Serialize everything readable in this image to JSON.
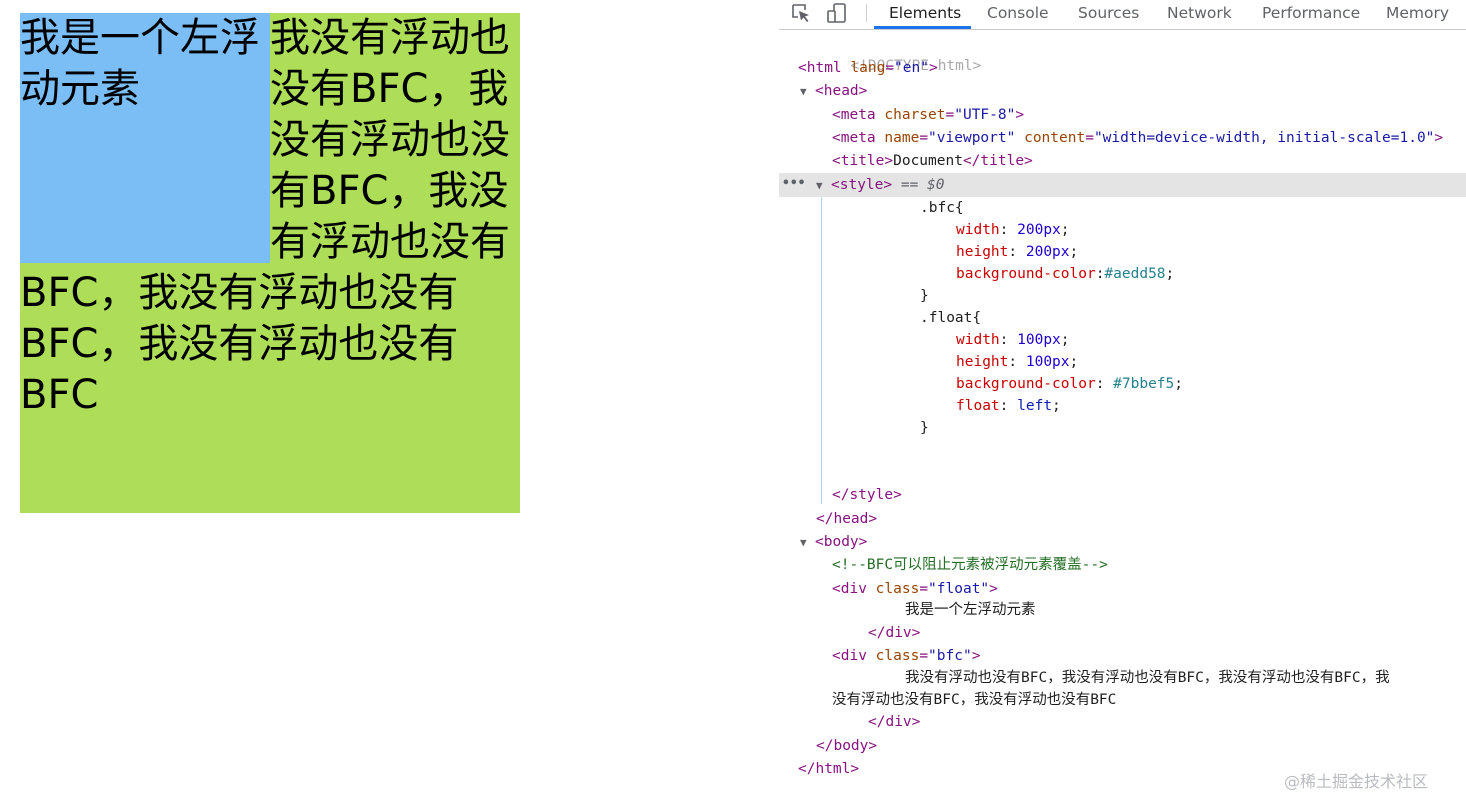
{
  "page": {
    "float_text": "我是一个左浮动元素",
    "bfc_text": "我没有浮动也没有BFC，我没有浮动也没有BFC，我没有浮动也没有BFC，我没有浮动也没有BFC，我没有浮动也没有BFC",
    "colors": {
      "float_bg": "#7bbef5",
      "bfc_bg": "#aedd58"
    }
  },
  "devtools": {
    "tabs": [
      "Elements",
      "Console",
      "Sources",
      "Network",
      "Performance",
      "Memory"
    ],
    "active_tab": "Elements",
    "icons": [
      "inspect-element-icon",
      "device-toolbar-icon"
    ],
    "selected_marker": "== $0",
    "lines": {
      "doctype": "<!DOCTYPE html>",
      "html_open_tag": "<html",
      "html_lang_attr": "lang",
      "html_lang_val": "\"en\"",
      "head_open": "<head>",
      "meta1_tag": "<meta",
      "meta1_attr": "charset",
      "meta1_val": "\"UTF-8\"",
      "meta2_tag": "<meta",
      "meta2_attr1": "name",
      "meta2_val1": "\"viewport\"",
      "meta2_attr2": "content",
      "meta2_val2": "\"width=device-width, initial-scale=1.0\"",
      "title_open": "<title>",
      "title_text": "Document",
      "title_close": "</title>",
      "style_open": "<style>",
      "css_bfc_selector": ".bfc{",
      "css_bfc_width_prop": "width",
      "css_bfc_width_val": "200px",
      "css_bfc_height_prop": "height",
      "css_bfc_height_val": "200px",
      "css_bfc_bg_prop": "background-color",
      "css_bfc_bg_val": "#aedd58",
      "css_close1": "}",
      "css_float_selector": ".float{",
      "css_float_width_prop": "width",
      "css_float_width_val": "100px",
      "css_float_height_prop": "height",
      "css_float_height_val": "100px",
      "css_float_bg_prop": "background-color",
      "css_float_bg_val": "#7bbef5",
      "css_float_float_prop": "float",
      "css_float_float_val": "left",
      "css_close2": "}",
      "style_close": "</style>",
      "head_close": "</head>",
      "body_open": "<body>",
      "comment": "<!--BFC可以阻止元素被浮动元素覆盖-->",
      "div_float_tag": "<div",
      "div_float_attr": "class",
      "div_float_val": "\"float\"",
      "div_float_text": "我是一个左浮动元素",
      "div_float_close": "</div>",
      "div_bfc_tag": "<div",
      "div_bfc_attr": "class",
      "div_bfc_val": "\"bfc\"",
      "div_bfc_text1": "我没有浮动也没有BFC，我没有浮动也没有BFC，我没有浮动也没有BFC，我",
      "div_bfc_text2": "没有浮动也没有BFC，我没有浮动也没有BFC",
      "div_bfc_close": "</div>",
      "body_close": "</body>",
      "html_close": "</html>"
    }
  },
  "watermark": "@稀土掘金技术社区"
}
